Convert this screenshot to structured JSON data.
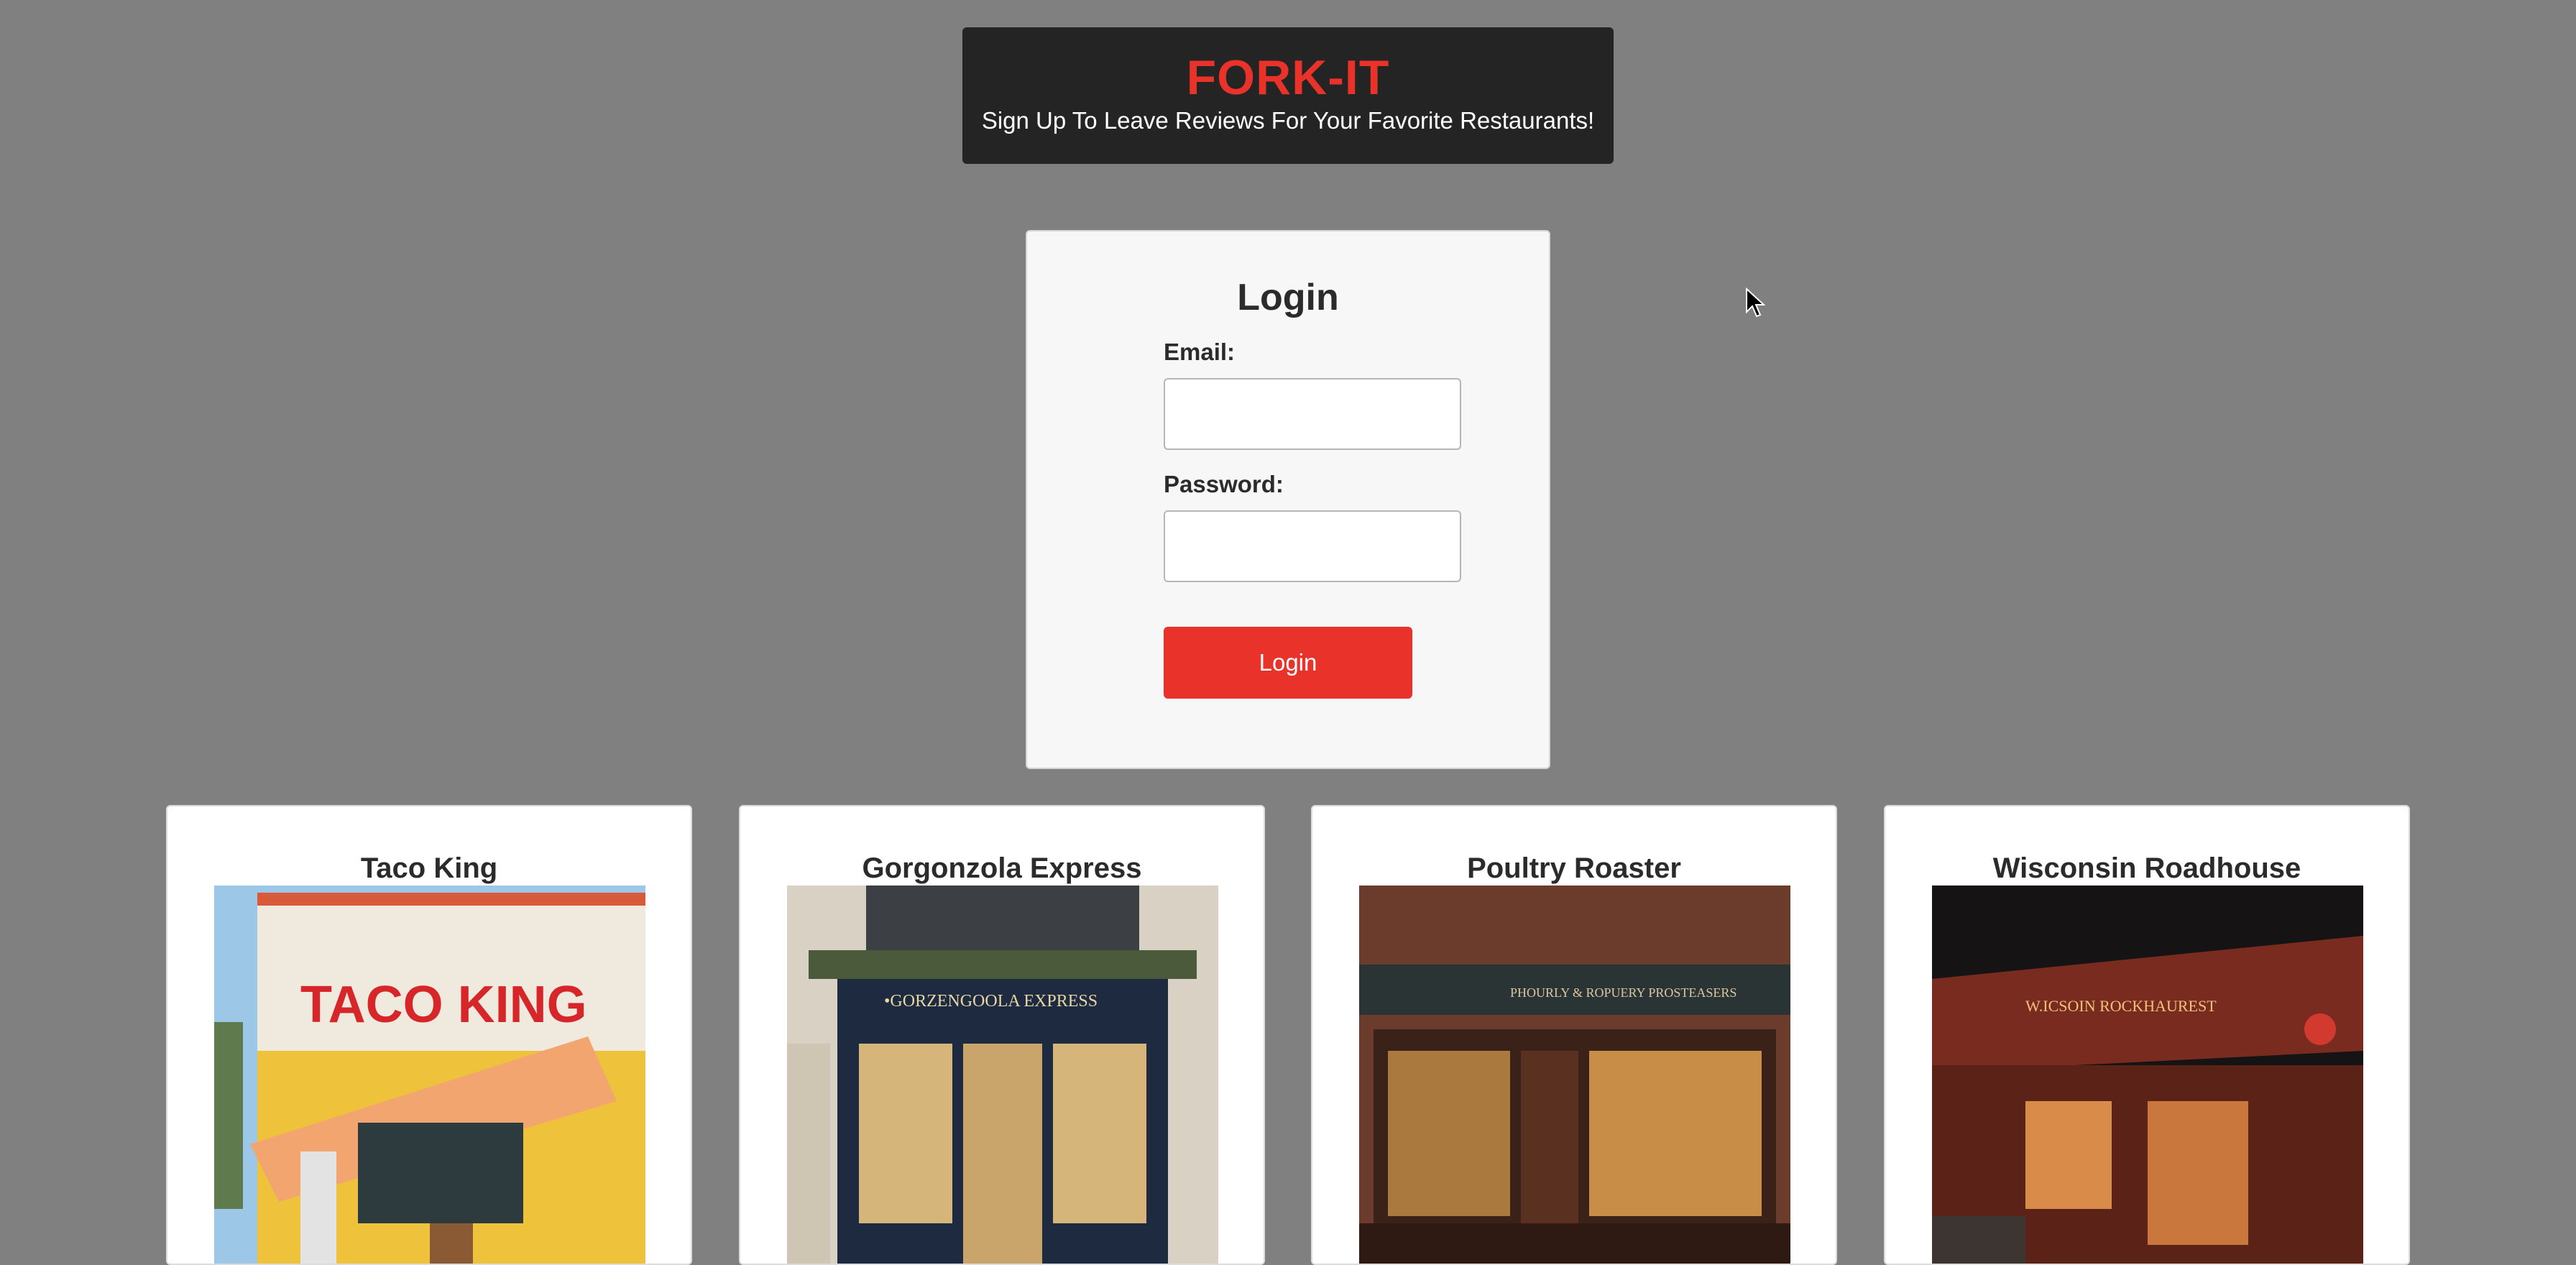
{
  "header": {
    "brand": "FORK-IT",
    "tagline": "Sign Up To Leave Reviews For Your Favorite Restaurants!"
  },
  "login": {
    "title": "Login",
    "email_label": "Email:",
    "email_value": "",
    "password_label": "Password:",
    "password_value": "",
    "submit_label": "Login"
  },
  "restaurants": [
    {
      "name": "Taco King",
      "image_icon": "taco-king-storefront-image",
      "sign_text": "TACO KING"
    },
    {
      "name": "Gorgonzola Express",
      "image_icon": "gorgonzola-express-storefront-image",
      "sign_text": "•GORZENGOOLA EXPRESS"
    },
    {
      "name": "Poultry Roaster",
      "image_icon": "poultry-roaster-storefront-image",
      "sign_text": "PHOURLY & ROPUERY PROSTEASERS"
    },
    {
      "name": "Wisconsin Roadhouse",
      "image_icon": "wisconsin-roadhouse-storefront-image",
      "sign_text": "W.ICSOIN ROCKHAUREST"
    }
  ],
  "colors": {
    "background": "#808080",
    "header_bg": "#242424",
    "brand_red": "#e8322a",
    "card_bg": "#ffffff",
    "login_card_bg": "#f7f7f7"
  }
}
